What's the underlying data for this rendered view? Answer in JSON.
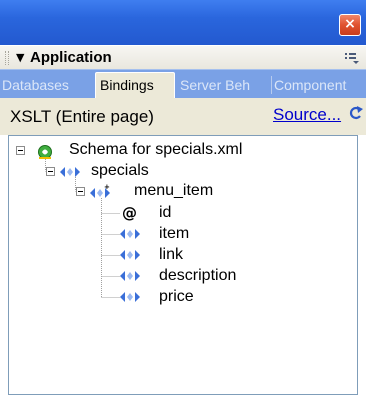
{
  "window": {
    "close_glyph": "×"
  },
  "panel": {
    "collapse_glyph": "▼",
    "title": "Application",
    "options_icon": "panel-options-icon"
  },
  "tabs": [
    {
      "label": "Databases",
      "active": false
    },
    {
      "label": "Bindings",
      "active": true
    },
    {
      "label": "Server Beh",
      "active": false
    },
    {
      "label": "Component",
      "active": false
    }
  ],
  "toolbar": {
    "document_type": "XSLT (Entire page)",
    "source_link": "Source...",
    "refresh_icon": "refresh-icon"
  },
  "tree": {
    "root": {
      "label": "Schema for specials.xml",
      "icon": "schema-icon",
      "expanded": true
    },
    "specials": {
      "label": "specials",
      "icon": "element-icon",
      "expanded": true
    },
    "menu_item": {
      "label": "menu_item",
      "icon": "repeating-element-icon",
      "expanded": true
    },
    "children": [
      {
        "label": "id",
        "icon": "attribute-icon",
        "glyph": "@"
      },
      {
        "label": "item",
        "icon": "element-icon"
      },
      {
        "label": "link",
        "icon": "element-icon"
      },
      {
        "label": "description",
        "icon": "element-icon"
      },
      {
        "label": "price",
        "icon": "element-icon"
      }
    ]
  },
  "colors": {
    "titlebar": "#2a66dd",
    "close_button": "#e0522f",
    "tabbar": "#7aa1e6",
    "panel_face": "#ece9d8",
    "link": "#0000cc",
    "element_icon": "#3a6fd8",
    "schema_icon": "#3fae3f"
  }
}
